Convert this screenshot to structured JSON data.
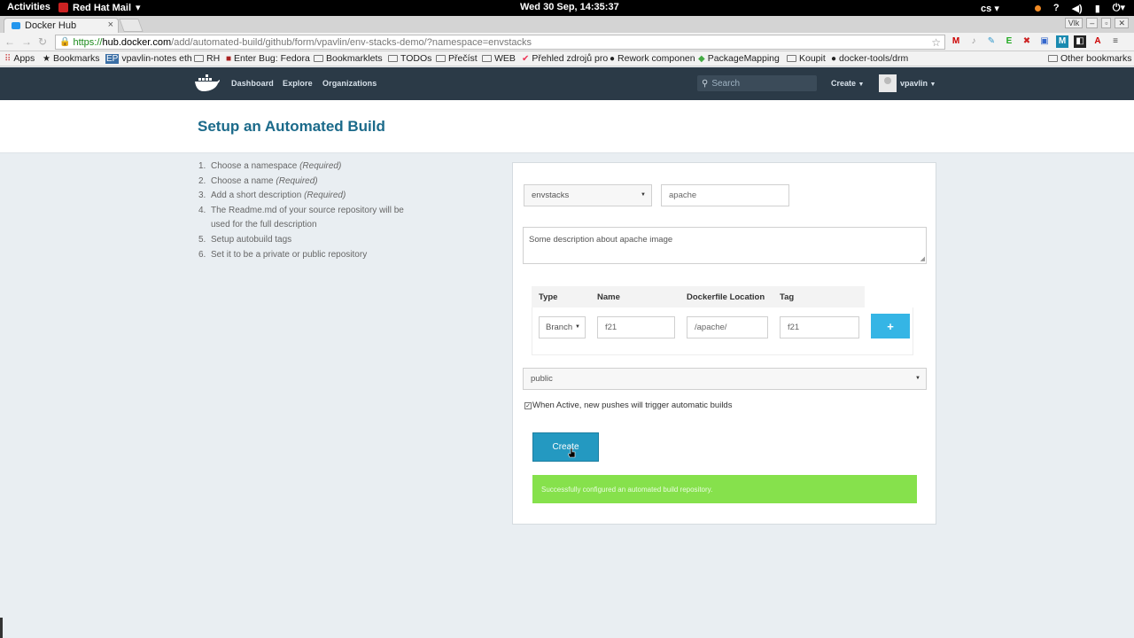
{
  "system_bar": {
    "activities": "Activities",
    "app_name": "Red Hat Mail",
    "clock": "Wed 30 Sep, 14:35:37",
    "lang": "cs"
  },
  "browser": {
    "tab_title": "Docker Hub",
    "tab_close": "×",
    "window_label": "Vlk",
    "url_scheme": "https://",
    "url_host": "hub.docker.com",
    "url_path": "/add/automated-build/github/form/vpavlin/env-stacks-demo/?namespace=envstacks",
    "bookmarks": [
      "Apps",
      "Bookmarks",
      "vpavlin-notes eth",
      "RH",
      "Enter Bug: Fedora",
      "Bookmarklets",
      "TODOs",
      "Přečíst",
      "WEB",
      "Přehled zdrojů pro",
      "Rework componen",
      "PackageMapping",
      "Koupit",
      "docker-tools/drm",
      "Other bookmarks"
    ]
  },
  "docker_nav": {
    "dashboard": "Dashboard",
    "explore": "Explore",
    "organizations": "Organizations",
    "search_placeholder": "Search",
    "create": "Create",
    "username": "vpavlin"
  },
  "page": {
    "title": "Setup an Automated Build"
  },
  "steps": [
    {
      "n": "1.",
      "text": "Choose a namespace ",
      "req": "(Required)"
    },
    {
      "n": "2.",
      "text": "Choose a name ",
      "req": "(Required)"
    },
    {
      "n": "3.",
      "text": "Add a short description ",
      "req": "(Required)"
    },
    {
      "n": "4.",
      "text": "The Readme.md of your source repository will be used for the full description",
      "req": ""
    },
    {
      "n": "5.",
      "text": "Setup autobuild tags",
      "req": ""
    },
    {
      "n": "6.",
      "text": "Set it to be a private or public repository",
      "req": ""
    }
  ],
  "form": {
    "namespace": "envstacks",
    "name": "apache",
    "description": "Some description about apache image",
    "table_headers": {
      "type": "Type",
      "name": "Name",
      "dockerfile_location": "Dockerfile Location",
      "tag": "Tag"
    },
    "row": {
      "type": "Branch",
      "name": "f21",
      "dockerfile_location": "/apache/",
      "tag": "f21"
    },
    "add_button": "+",
    "visibility": "public",
    "active_label": "When Active, new pushes will trigger automatic builds",
    "active_checked": true,
    "create_button": "Create",
    "success_message": "Successfully configured an automated build repository."
  },
  "colors": {
    "header_bg": "#2b3a47",
    "title": "#1b6a8a",
    "primary_button": "#2499c1",
    "add_button": "#35b5e5",
    "success_bg": "#86e14c"
  }
}
